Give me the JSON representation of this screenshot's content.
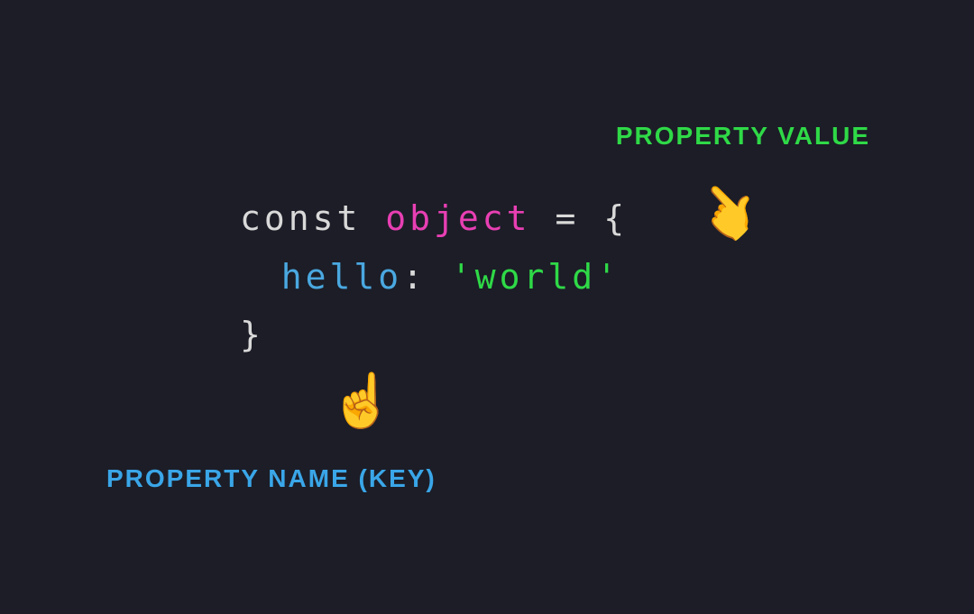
{
  "labels": {
    "valueLabel": "PROPERTY VALUE",
    "keyLabel": "PROPERTY NAME (KEY)"
  },
  "code": {
    "kw_const": "const",
    "ident": "object",
    "eq": "=",
    "brace_open": "{",
    "prop_name": "hello",
    "colon": ":",
    "string": "'world'",
    "brace_close": "}"
  },
  "icons": {
    "hand_value": "👈",
    "hand_key": "☝️"
  }
}
